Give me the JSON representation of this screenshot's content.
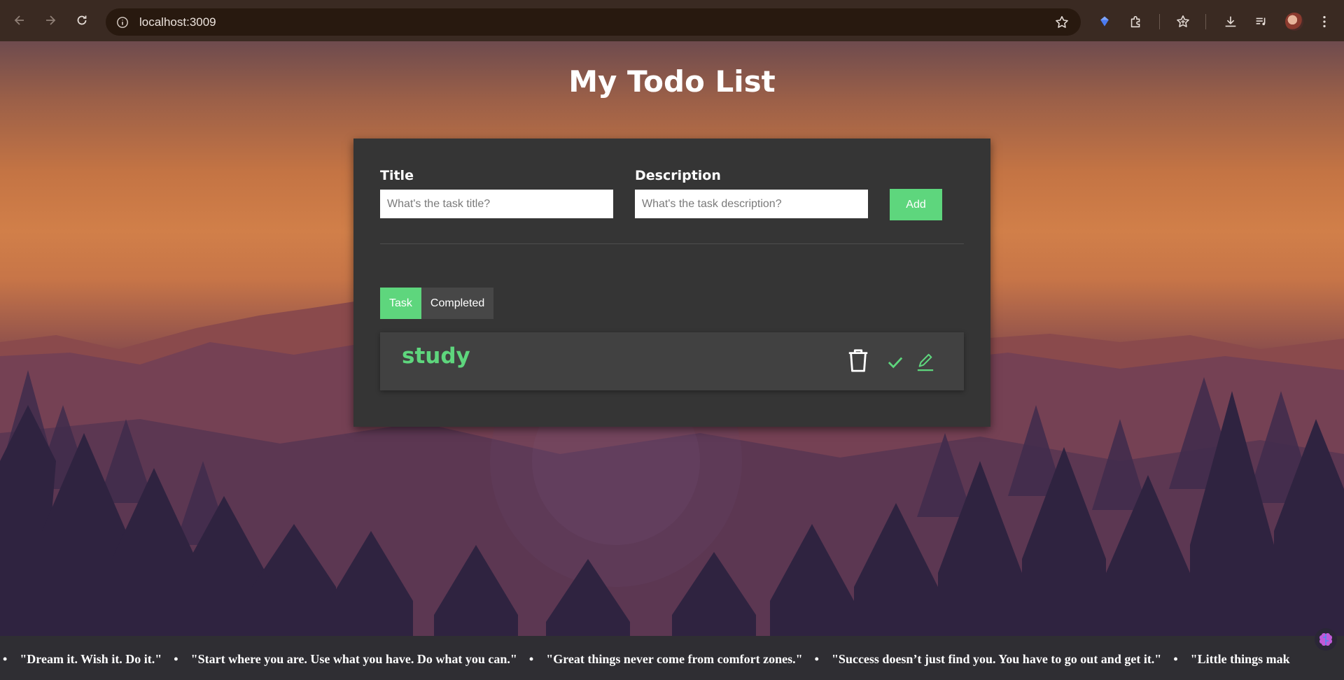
{
  "browser": {
    "url": "localhost:3009"
  },
  "page": {
    "title": "My Todo List"
  },
  "form": {
    "title_label": "Title",
    "title_placeholder": "What's the task title?",
    "title_value": "",
    "description_label": "Description",
    "description_placeholder": "What's the task description?",
    "description_value": "",
    "add_label": "Add"
  },
  "tabs": [
    {
      "label": "Task",
      "active": true
    },
    {
      "label": "Completed",
      "active": false
    }
  ],
  "todos": [
    {
      "title": "study"
    }
  ],
  "ticker": {
    "quotes": [
      "\"Dream it. Wish it. Do it.\"",
      "\"Start where you are. Use what you have. Do what you can.\"",
      "\"Great things never come from comfort zones.\"",
      "\"Success doesn’t just find you. You have to go out and get it.\"",
      "\"Little things mak"
    ],
    "separator": "•"
  },
  "colors": {
    "accent": "#5ed67d",
    "card": "#353535",
    "item": "#414141"
  }
}
